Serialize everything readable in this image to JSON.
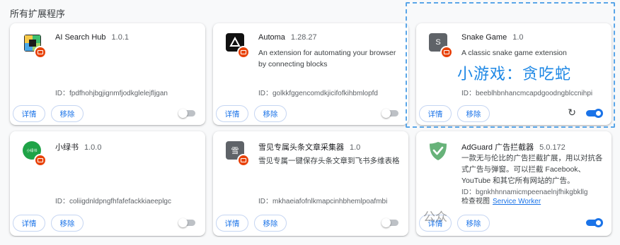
{
  "section_title": "所有扩展程序",
  "labels": {
    "details": "详情",
    "remove": "移除"
  },
  "overlay_text": "小游戏：贪吃蛇",
  "watermark_text": "公众",
  "extensions": [
    {
      "name": "AI Search Hub",
      "version": "1.0.1",
      "description": "",
      "id": "ID：fpdfhohjbgjignmfjodkglelejfljgan",
      "enabled": false,
      "icon": "ai-search-hub-icon",
      "icon_color": "#3dbf6e"
    },
    {
      "name": "Automa",
      "version": "1.28.27",
      "description": "An extension for automating your browser by connecting blocks",
      "id": "ID：golkkfggencomdkjicifofkihbmlopfd",
      "enabled": false,
      "icon": "automa-icon",
      "icon_color": "#111111"
    },
    {
      "name": "Snake Game",
      "version": "1.0",
      "description": "A classic snake game extension",
      "id": "ID：beeblhbnhancmcapdgoodngblccnihpi",
      "enabled": true,
      "icon": "snake-game-icon",
      "icon_letter": "S",
      "icon_color": "#5f6368"
    },
    {
      "name": "小绿书",
      "version": "1.0.0",
      "description": "",
      "id": "ID：coliigdnldpngfhfafefackkiaeeplgc",
      "enabled": false,
      "icon": "xiaolvshu-icon",
      "icon_text": "小绿书",
      "icon_color": "#1fa347"
    },
    {
      "name": "雪见专属头条文章采集器",
      "version": "1.0",
      "description": "雪见专属一键保存头条文章到飞书多维表格",
      "id": "ID：mkhaeiafofnlkmapcinhbhemlpoafmbi",
      "enabled": false,
      "icon": "xuejian-icon",
      "icon_letter": "雪",
      "icon_color": "#5f6368"
    },
    {
      "name": "AdGuard 广告拦截器",
      "version": "5.0.172",
      "description": "一款无与伦比的广告拦截扩展，用以对抗各式广告与弹窗。可以拦截 Facebook、YouTube 和其它所有网站的广告。",
      "id": "ID：bgnkhhnnamicmpeenaelnjfhikgbkllg",
      "enabled": true,
      "icon": "adguard-shield-icon",
      "icon_color": "#67b279",
      "inspect_label": "检查视图",
      "inspect_link": "Service Worker"
    }
  ]
}
